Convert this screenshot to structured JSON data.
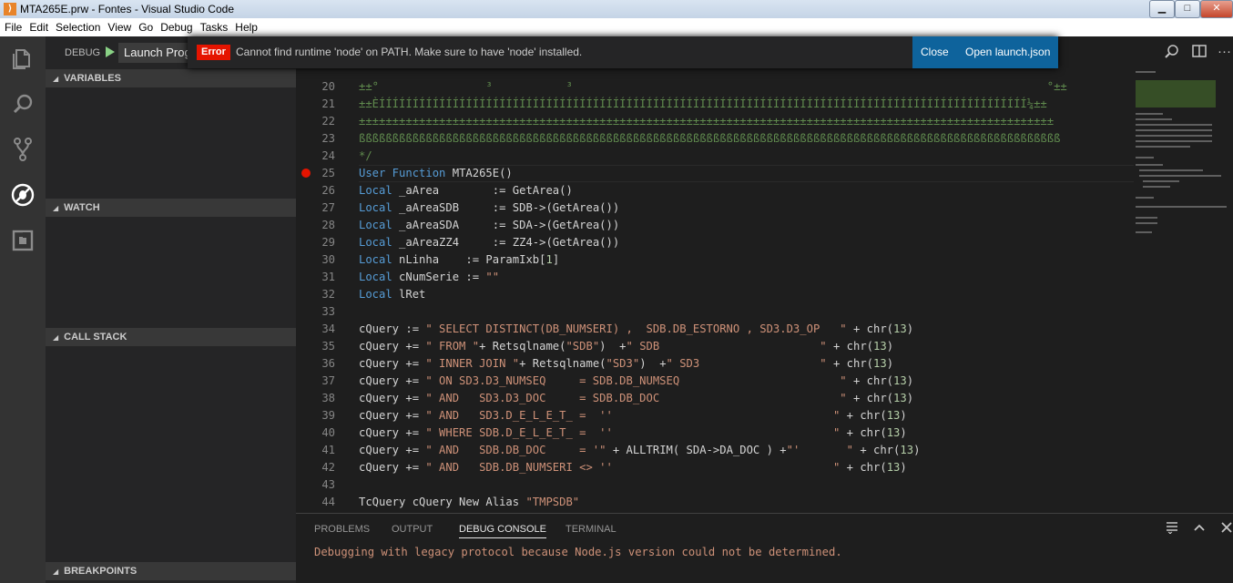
{
  "window": {
    "title": "MTA265E.prw - Fontes - Visual Studio Code",
    "controls": {
      "minimize": "▁",
      "maximize": "□",
      "close": "✕"
    }
  },
  "menu": [
    "File",
    "Edit",
    "Selection",
    "View",
    "Go",
    "Debug",
    "Tasks",
    "Help"
  ],
  "activity_icons": [
    "files-icon",
    "search-icon",
    "source-control-icon",
    "debug-icon",
    "extensions-icon"
  ],
  "debug": {
    "label": "DEBUG",
    "launch_config": "Launch Program"
  },
  "sidebar_sections": {
    "variables": "VARIABLES",
    "watch": "WATCH",
    "call_stack": "CALL STACK",
    "breakpoints": "BREAKPOINTS"
  },
  "notification": {
    "badge": "Error",
    "message": "Cannot find runtime 'node' on PATH. Make sure to have 'node' installed.",
    "close_label": "Close",
    "open_label": "Open launch.json"
  },
  "editor": {
    "lines": [
      {
        "n": "20",
        "segments": [
          {
            "t": "±±°                ³           ³                                                                       °±±",
            "c": "cmt"
          }
        ]
      },
      {
        "n": "21",
        "segments": [
          {
            "t": "±±ÈÍÍÍÍÍÍÍÍÍÍÍÍÍÍÍÍÍÍÍÍÍÍÍÍÍÍÍÍÍÍÍÍÍÍÍÍÍÍÍÍÍÍÍÍÍÍÍÍÍÍÍÍÍÍÍÍÍÍÍÍÍÍÍÍÍÍÍÍÍÍÍÍÍÍÍÍÍÍÍÍÍÍÍÍÍÍÍÍÍÍÍÍÍÍÍÍÍ¼±±",
            "c": "cmt"
          }
        ]
      },
      {
        "n": "22",
        "segments": [
          {
            "t": "±±±±±±±±±±±±±±±±±±±±±±±±±±±±±±±±±±±±±±±±±±±±±±±±±±±±±±±±±±±±±±±±±±±±±±±±±±±±±±±±±±±±±±±±±±±±±±±±±±±±±±±±",
            "c": "cmt"
          }
        ]
      },
      {
        "n": "23",
        "segments": [
          {
            "t": "ßßßßßßßßßßßßßßßßßßßßßßßßßßßßßßßßßßßßßßßßßßßßßßßßßßßßßßßßßßßßßßßßßßßßßßßßßßßßßßßßßßßßßßßßßßßßßßßßßßßßßßßßß",
            "c": "cmt"
          }
        ]
      },
      {
        "n": "24",
        "segments": [
          {
            "t": "*/",
            "c": "cmt"
          }
        ]
      },
      {
        "n": "25",
        "segments": [
          {
            "t": "User Function ",
            "c": "kw"
          },
          {
            "t": "MTA265E()",
            "c": ""
          }
        ]
      },
      {
        "n": "26",
        "segments": [
          {
            "t": "Local ",
            "c": "kw"
          },
          {
            "t": "_aArea        := GetArea()",
            "c": ""
          }
        ]
      },
      {
        "n": "27",
        "segments": [
          {
            "t": "Local ",
            "c": "kw"
          },
          {
            "t": "_aAreaSDB     := SDB->(GetArea())",
            "c": ""
          }
        ]
      },
      {
        "n": "28",
        "segments": [
          {
            "t": "Local ",
            "c": "kw"
          },
          {
            "t": "_aAreaSDA     := SDA->(GetArea())",
            "c": ""
          }
        ]
      },
      {
        "n": "29",
        "segments": [
          {
            "t": "Local ",
            "c": "kw"
          },
          {
            "t": "_aAreaZZ4     := ZZ4->(GetArea())",
            "c": ""
          }
        ]
      },
      {
        "n": "30",
        "segments": [
          {
            "t": "Local ",
            "c": "kw"
          },
          {
            "t": "nLinha    := ParamIxb[",
            "c": ""
          },
          {
            "t": "1",
            "c": "num"
          },
          {
            "t": "]",
            "c": ""
          }
        ]
      },
      {
        "n": "31",
        "segments": [
          {
            "t": "Local ",
            "c": "kw"
          },
          {
            "t": "cNumSerie := ",
            "c": ""
          },
          {
            "t": "\"\"",
            "c": "str"
          }
        ]
      },
      {
        "n": "32",
        "segments": [
          {
            "t": "Local ",
            "c": "kw"
          },
          {
            "t": "lRet",
            "c": ""
          }
        ]
      },
      {
        "n": "33",
        "segments": []
      },
      {
        "n": "34",
        "segments": [
          {
            "t": "cQuery := ",
            "c": ""
          },
          {
            "t": "\" SELECT DISTINCT(DB_NUMSERI) ,  SDB.DB_ESTORNO , SD3.D3_OP   \"",
            "c": "str"
          },
          {
            "t": " + chr(",
            "c": ""
          },
          {
            "t": "13",
            "c": "num"
          },
          {
            "t": ")",
            "c": ""
          }
        ]
      },
      {
        "n": "35",
        "segments": [
          {
            "t": "cQuery += ",
            "c": ""
          },
          {
            "t": "\" FROM \"",
            "c": "str"
          },
          {
            "t": "+ Retsqlname(",
            "c": ""
          },
          {
            "t": "\"SDB\"",
            "c": "str"
          },
          {
            "t": ")  +",
            "c": ""
          },
          {
            "t": "\" SDB                        \"",
            "c": "str"
          },
          {
            "t": " + chr(",
            "c": ""
          },
          {
            "t": "13",
            "c": "num"
          },
          {
            "t": ")",
            "c": ""
          }
        ]
      },
      {
        "n": "36",
        "segments": [
          {
            "t": "cQuery += ",
            "c": ""
          },
          {
            "t": "\" INNER JOIN \"",
            "c": "str"
          },
          {
            "t": "+ Retsqlname(",
            "c": ""
          },
          {
            "t": "\"SD3\"",
            "c": "str"
          },
          {
            "t": ")  +",
            "c": ""
          },
          {
            "t": "\" SD3                  \"",
            "c": "str"
          },
          {
            "t": " + chr(",
            "c": ""
          },
          {
            "t": "13",
            "c": "num"
          },
          {
            "t": ")",
            "c": ""
          }
        ]
      },
      {
        "n": "37",
        "segments": [
          {
            "t": "cQuery += ",
            "c": ""
          },
          {
            "t": "\" ON SD3.D3_NUMSEQ     = SDB.DB_NUMSEQ                        \"",
            "c": "str"
          },
          {
            "t": " + chr(",
            "c": ""
          },
          {
            "t": "13",
            "c": "num"
          },
          {
            "t": ")",
            "c": ""
          }
        ]
      },
      {
        "n": "38",
        "segments": [
          {
            "t": "cQuery += ",
            "c": ""
          },
          {
            "t": "\" AND   SD3.D3_DOC     = SDB.DB_DOC                           \"",
            "c": "str"
          },
          {
            "t": " + chr(",
            "c": ""
          },
          {
            "t": "13",
            "c": "num"
          },
          {
            "t": ")",
            "c": ""
          }
        ]
      },
      {
        "n": "39",
        "segments": [
          {
            "t": "cQuery += ",
            "c": ""
          },
          {
            "t": "\" AND   SD3.D_E_L_E_T_ =  ''                                 \"",
            "c": "str"
          },
          {
            "t": " + chr(",
            "c": ""
          },
          {
            "t": "13",
            "c": "num"
          },
          {
            "t": ")",
            "c": ""
          }
        ]
      },
      {
        "n": "40",
        "segments": [
          {
            "t": "cQuery += ",
            "c": ""
          },
          {
            "t": "\" WHERE SDB.D_E_L_E_T_ =  ''                                 \"",
            "c": "str"
          },
          {
            "t": " + chr(",
            "c": ""
          },
          {
            "t": "13",
            "c": "num"
          },
          {
            "t": ")",
            "c": ""
          }
        ]
      },
      {
        "n": "41",
        "segments": [
          {
            "t": "cQuery += ",
            "c": ""
          },
          {
            "t": "\" AND   SDB.DB_DOC     = '\"",
            "c": "str"
          },
          {
            "t": " + ALLTRIM( SDA->DA_DOC ) +",
            "c": ""
          },
          {
            "t": "\"'       \"",
            "c": "str"
          },
          {
            "t": " + chr(",
            "c": ""
          },
          {
            "t": "13",
            "c": "num"
          },
          {
            "t": ")",
            "c": ""
          }
        ]
      },
      {
        "n": "42",
        "segments": [
          {
            "t": "cQuery += ",
            "c": ""
          },
          {
            "t": "\" AND   SDB.DB_NUMSERI <> ''                                 \"",
            "c": "str"
          },
          {
            "t": " + chr(",
            "c": ""
          },
          {
            "t": "13",
            "c": "num"
          },
          {
            "t": ")",
            "c": ""
          }
        ]
      },
      {
        "n": "43",
        "segments": []
      },
      {
        "n": "44",
        "segments": [
          {
            "t": "TcQuery cQuery New Alias ",
            "c": ""
          },
          {
            "t": "\"TMPSDB\"",
            "c": "str"
          }
        ]
      }
    ]
  },
  "panel": {
    "tabs": [
      "PROBLEMS",
      "OUTPUT",
      "DEBUG CONSOLE",
      "TERMINAL"
    ],
    "active_tab": "DEBUG CONSOLE",
    "output": "Debugging with legacy protocol because Node.js version could not be determined."
  }
}
